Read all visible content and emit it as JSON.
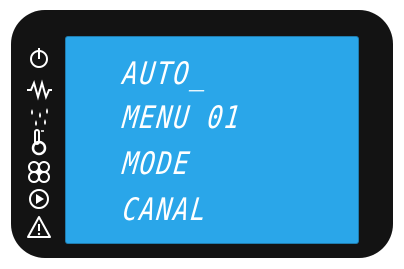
{
  "display": {
    "lines": [
      "AUTO_",
      "MENU 01",
      "MODE",
      "CANAL"
    ]
  },
  "icons": [
    "power-icon",
    "heating-coil-icon",
    "dripping-water-icon",
    "thermometer-icon",
    "fan-icon",
    "play-icon",
    "warning-icon"
  ],
  "colors": {
    "bezel": "#131313",
    "screen": "#2aa6e9",
    "text": "#ffffff"
  }
}
